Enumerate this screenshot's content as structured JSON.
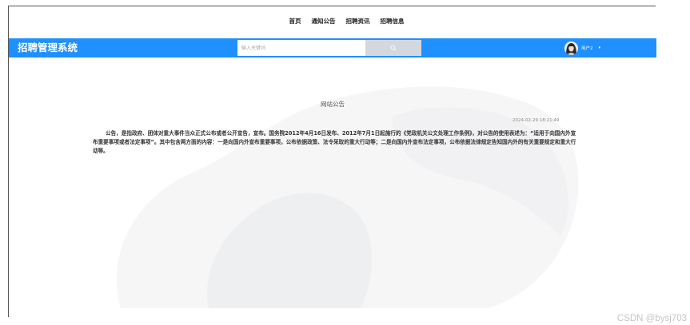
{
  "topnav": {
    "items": [
      {
        "label": "首页"
      },
      {
        "label": "通知公告"
      },
      {
        "label": "招聘资讯"
      },
      {
        "label": "招聘信息"
      }
    ]
  },
  "header": {
    "brand": "招聘管理系统",
    "search_placeholder": "输入关键词",
    "user_name": "用户2",
    "accent_color": "#1e90ff"
  },
  "notice": {
    "title": "网站公告",
    "date": "2024-02-29 18:21:49",
    "body": "公告，是指政府、团体对重大事件当众正式公布或者公开宣告，宣布。国务院2012年4月16日发布、2012年7月1日起施行的《党政机关公文处理工作条例》，对公告的使用表述为：“适用于向国内外宣布重要事项或者法定事项”。其中包含两方面的内容：一是向国内外宣布重要事项，公布依据政策、法令采取的重大行动等；二是向国内外宣布法定事项，公布依据法律规定告知国内外的有关重要规定和重大行动等。"
  },
  "watermark": "CSDN @bysj703"
}
